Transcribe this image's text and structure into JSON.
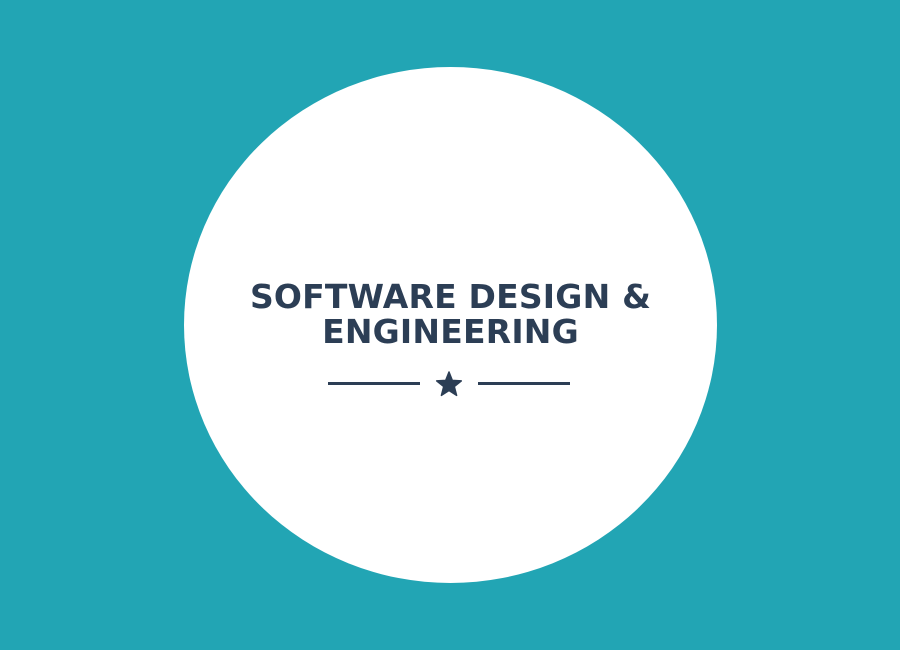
{
  "colors": {
    "background": "#22a5b4",
    "circle": "#ffffff",
    "text": "#2c3e55"
  },
  "title": {
    "line1": "SOFTWARE DESIGN &",
    "line2": "ENGINEERING"
  },
  "divider": {
    "icon": "star-icon"
  }
}
